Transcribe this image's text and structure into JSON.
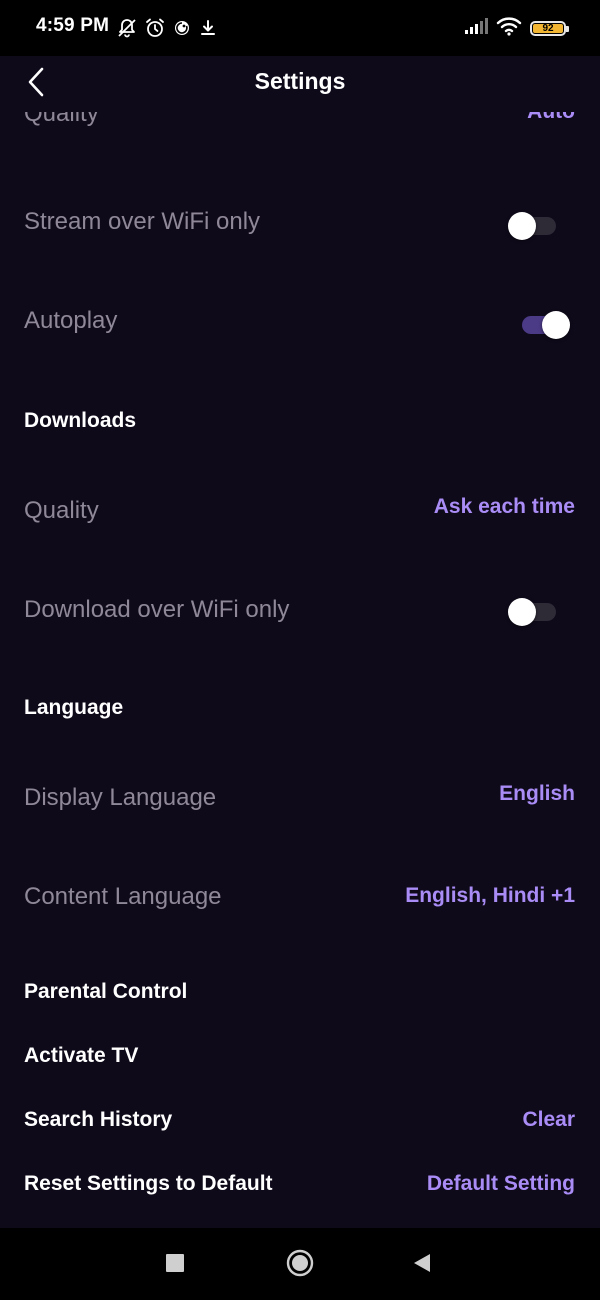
{
  "status_bar": {
    "time": "4:59 PM",
    "battery_level": "92",
    "icons": [
      "mute-notifications-icon",
      "alarm-icon",
      "app-notification-icon",
      "download-icon",
      "signal-icon",
      "wifi-icon",
      "battery-icon"
    ]
  },
  "header": {
    "title": "Settings",
    "back_icon": "back-chevron-icon"
  },
  "streaming": {
    "quality_label": "Quality",
    "quality_value": "Auto",
    "wifi_only_label": "Stream over WiFi only",
    "wifi_only_enabled": false,
    "autoplay_label": "Autoplay",
    "autoplay_enabled": true
  },
  "downloads": {
    "header": "Downloads",
    "quality_label": "Quality",
    "quality_value": "Ask each time",
    "wifi_only_label": "Download over WiFi only",
    "wifi_only_enabled": false
  },
  "language": {
    "header": "Language",
    "display_label": "Display Language",
    "display_value": "English",
    "content_label": "Content Language",
    "content_value": "English, Hindi +1"
  },
  "actions": {
    "parental_control": "Parental Control",
    "activate_tv": "Activate TV",
    "search_history_label": "Search History",
    "search_history_action": "Clear",
    "reset_label": "Reset Settings to Default",
    "reset_action": "Default Setting"
  },
  "nav_bar": {
    "icons": [
      "recents-square-icon",
      "home-circle-icon",
      "back-triangle-icon"
    ]
  },
  "colors": {
    "background": "#0f0a1a",
    "accent": "#a98cf5",
    "toggle_on_track": "#4b3a86",
    "muted_text": "#8e8898"
  }
}
